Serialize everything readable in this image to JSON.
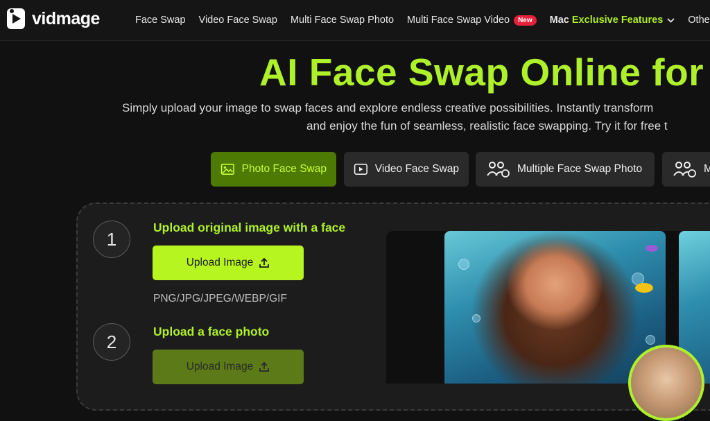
{
  "brand": {
    "name": "vidmage",
    "accent": "#aef02a"
  },
  "nav": {
    "items": [
      "Face Swap",
      "Video Face Swap",
      "Multi Face Swap Photo",
      "Multi Face Swap Video"
    ],
    "new_badge": "New",
    "mac": {
      "prefix": "Mac",
      "suffix": "Exclusive Features"
    },
    "other": "Other AI T"
  },
  "hero": {
    "title": "AI Face Swap Online for",
    "subtitle_line1": "Simply upload your image to swap faces and explore endless creative possibilities. Instantly transform",
    "subtitle_line2": "and enjoy the fun of seamless, realistic face swapping. Try it for free t"
  },
  "tabs": [
    {
      "label": "Photo Face Swap",
      "icon": "image-icon",
      "active": true
    },
    {
      "label": "Video Face Swap",
      "icon": "play-icon",
      "active": false
    },
    {
      "label": "Multiple Face Swap Photo",
      "icon": "group-swap-icon",
      "active": false
    },
    {
      "label": "M",
      "icon": "group-swap-icon",
      "active": false
    }
  ],
  "steps": [
    {
      "number": "1",
      "label": "Upload original image with a face",
      "button": "Upload Image",
      "formats": "PNG/JPG/JPEG/WEBP/GIF"
    },
    {
      "number": "2",
      "label": "Upload a face photo",
      "button": "Upload Image"
    }
  ]
}
